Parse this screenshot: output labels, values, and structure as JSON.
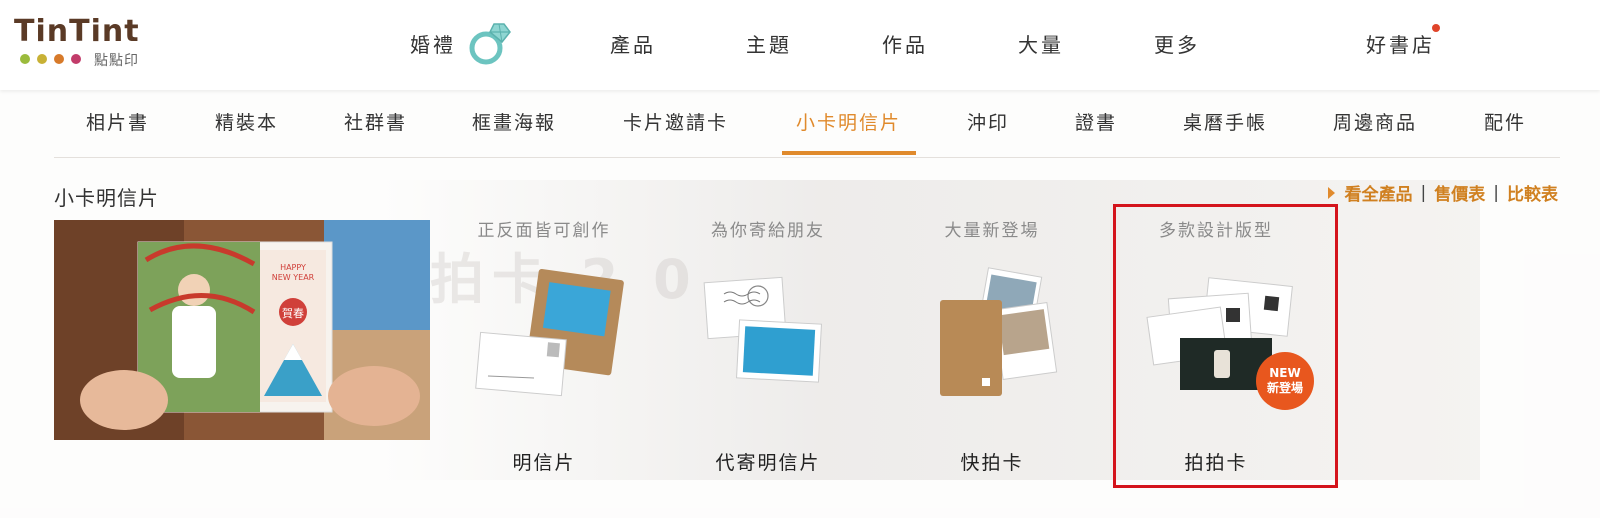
{
  "logo": {
    "wordmark": "TinTint",
    "sub": "點點印",
    "dot_colors": [
      "#9bbb3c",
      "#c8b135",
      "#d77a2a",
      "#c23c6a"
    ]
  },
  "topnav": {
    "items": [
      {
        "label": "婚禮"
      },
      {
        "label": "產品"
      },
      {
        "label": "主題"
      },
      {
        "label": "作品"
      },
      {
        "label": "大量"
      },
      {
        "label": "更多"
      },
      {
        "label": "好書店"
      }
    ],
    "notification_dot_color": "#e0442a"
  },
  "subnav": {
    "items": [
      {
        "label": "相片書"
      },
      {
        "label": "精裝本"
      },
      {
        "label": "社群書"
      },
      {
        "label": "框畫海報"
      },
      {
        "label": "卡片邀請卡"
      },
      {
        "label": "小卡明信片"
      },
      {
        "label": "沖印"
      },
      {
        "label": "證書"
      },
      {
        "label": "桌曆手帳"
      },
      {
        "label": "周邊商品"
      },
      {
        "label": "配件"
      }
    ],
    "active_index": 5,
    "accent_color": "#e08a2c"
  },
  "section": {
    "title": "小卡明信片",
    "links": [
      "看全產品",
      "售價表",
      "比較表"
    ],
    "separator": "|"
  },
  "hero": {
    "card_text": {
      "line1": "HAPPY",
      "line2": "NEW YEAR",
      "kanji": "賀春"
    }
  },
  "products": [
    {
      "tagline": "正反面皆可創作",
      "name": "明信片"
    },
    {
      "tagline": "為你寄給朋友",
      "name": "代寄明信片"
    },
    {
      "tagline": "大量新登場",
      "name": "快拍卡"
    },
    {
      "tagline": "多款設計版型",
      "name": "拍拍卡",
      "badge": {
        "line1": "NEW",
        "line2": "新登場"
      }
    }
  ],
  "highlight_color": "#d4141c"
}
